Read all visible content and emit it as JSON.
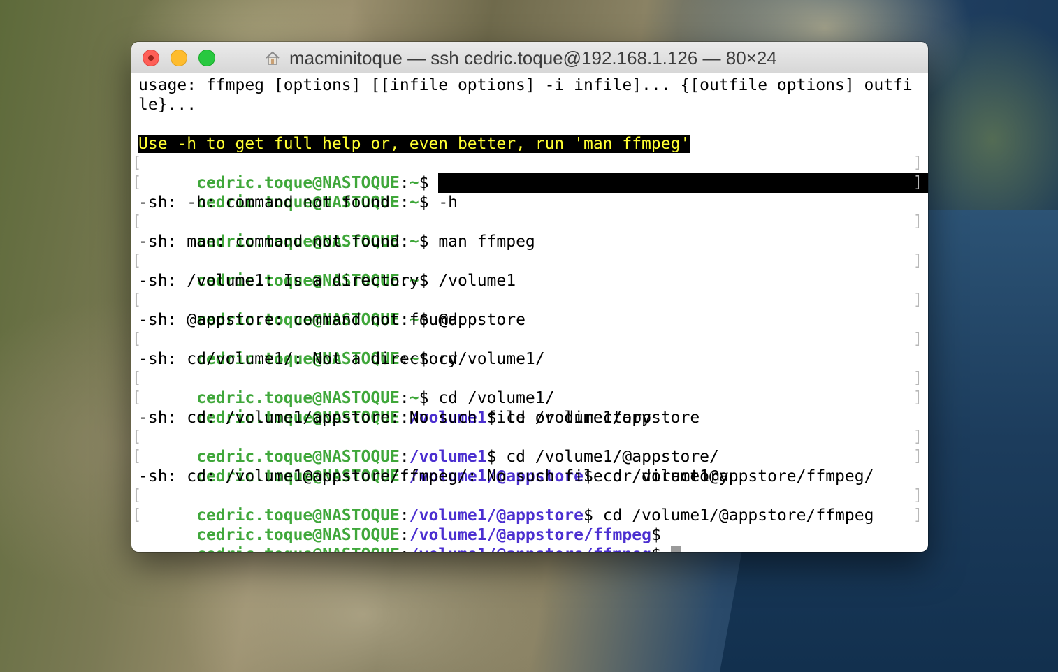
{
  "window": {
    "title": "macminitoque — ssh cedric.toque@192.168.1.126 — 80×24"
  },
  "terminal": {
    "usage_1": "usage: ffmpeg [options] [[infile options] -i infile]... {[outfile options] outfi",
    "usage_2": "le}...",
    "help_hint": "Use -h to get full help or, even better, run 'man ffmpeg'",
    "user": "cedric.toque@NASTOQUE",
    "colon": ":",
    "dollar": "$ ",
    "dollar_plain": "$",
    "bracket_left": "[",
    "bracket_right": "]",
    "paths": {
      "home": "~",
      "volume1": "/volume1",
      "appstore": "/volume1/@appstore",
      "ffmpeg": "/volume1/@appstore/ffmpeg"
    },
    "commands": {
      "c1": "-h",
      "c2": "man ffmpeg",
      "c3": "/volume1",
      "c4": "@appstore",
      "c5": "cd/volume1/",
      "c6": "cd /volume1/",
      "c7": "cd /volume1/appstore",
      "c8": "cd /volume1/@appstore/",
      "c9": "cd /volume1@appstore/ffmpeg/",
      "c10": "cd /volume1/@appstore/ffmpeg"
    },
    "outputs": {
      "o1": "-sh: -h: command not found",
      "o2": "-sh: man: command not found",
      "o3": "-sh: /volume1: Is a directory",
      "o4": "-sh: @appstore: command not found",
      "o5": "-sh: cd/volume1/: Not a directory",
      "o6": "-sh: cd: /volume1/appstore: No such file or directory",
      "o7": "-sh: cd: /volume1@appstore/ffmpeg/: No such file or directory"
    }
  },
  "colors": {
    "prompt_user": "#3fa73a",
    "prompt_path": "#4b2fd0",
    "highlight_fg": "#ffff33",
    "highlight_bg": "#000000"
  },
  "icons": {
    "title": "home-icon",
    "close": "close-button",
    "minimize": "minimize-button",
    "zoom": "zoom-button"
  }
}
